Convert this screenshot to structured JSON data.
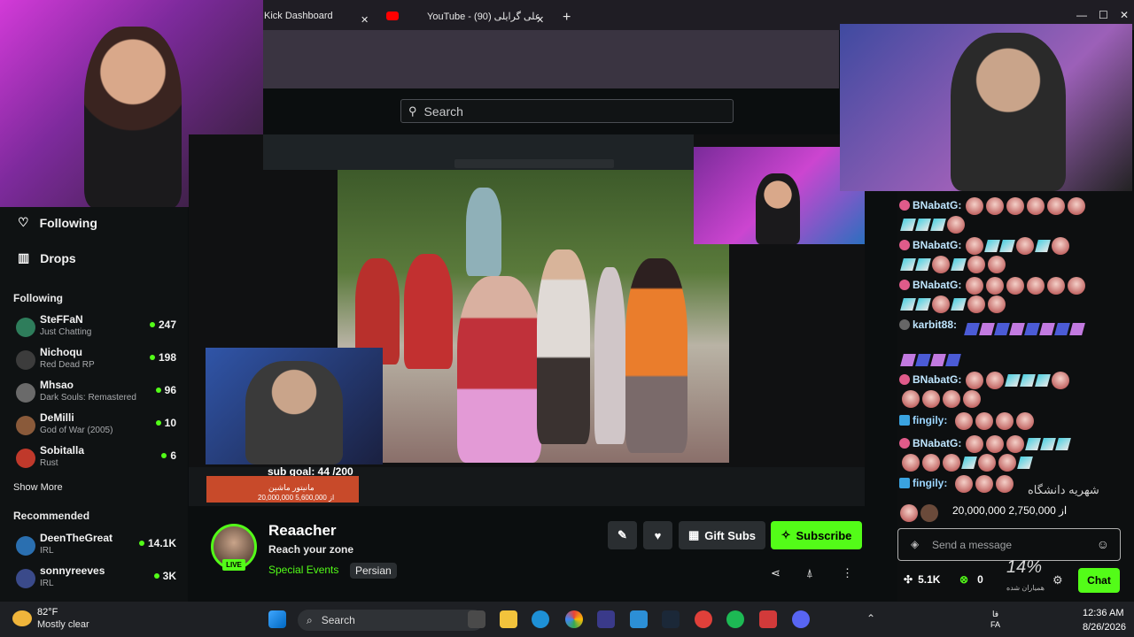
{
  "browser": {
    "tabs": [
      {
        "label": "Kick Dashboard"
      },
      {
        "label": "YouTube - علی گرایلی (90)"
      }
    ]
  },
  "search": {
    "placeholder": "Search"
  },
  "sidebar": {
    "following_label": "Following",
    "drops_label": "Drops",
    "following_title": "Following",
    "following": [
      {
        "name": "SteFFaN",
        "category": "Just Chatting",
        "viewers": "247"
      },
      {
        "name": "Nichoqu",
        "category": "Red Dead RP",
        "viewers": "198"
      },
      {
        "name": "Mhsao",
        "category": "Dark Souls: Remastered",
        "viewers": "96"
      },
      {
        "name": "DeMilli",
        "category": "God of War (2005)",
        "viewers": "10"
      },
      {
        "name": "Sobitalla",
        "category": "Rust",
        "viewers": "6"
      }
    ],
    "show_more": "Show More",
    "recommended_title": "Recommended",
    "recommended": [
      {
        "name": "DeenTheGreat",
        "category": "IRL",
        "viewers": "14.1K"
      },
      {
        "name": "sonnyreeves",
        "category": "IRL",
        "viewers": "3K"
      }
    ]
  },
  "overlay": {
    "sub_goal": "sub goal: 44 /200",
    "donation_title": "مانیتور ماشین",
    "donation_amount": "20,000,000 از 5,600,000"
  },
  "channel": {
    "name": "Reaacher",
    "title": "Reach your zone",
    "category": "Special Events",
    "tag": "Persian",
    "live": "LIVE",
    "gift_label": "Gift Subs",
    "subscribe_label": "Subscribe"
  },
  "chat": {
    "messages": [
      {
        "user": "BNabatG:",
        "color": "#bfe6ff"
      },
      {
        "user": "BNabatG:",
        "color": "#bfe6ff"
      },
      {
        "user": "BNabatG:",
        "color": "#bfe6ff"
      },
      {
        "user": "karbit88:",
        "color": "#bfe6ff"
      },
      {
        "user": "BNabatG:",
        "color": "#bfe6ff"
      },
      {
        "user": "fingily:",
        "color": "#9dd7ff"
      },
      {
        "user": "BNabatG:",
        "color": "#bfe6ff"
      },
      {
        "user": "fingily:",
        "color": "#9dd7ff"
      }
    ],
    "overlay_text": "20,000,000 از 2,750,000",
    "overlay_fa": "شهریه دانشگاه",
    "percent": "14%",
    "percent_sub": "همیاران شده",
    "input_placeholder": "Send a message",
    "kicks": "5.1K",
    "points": "0",
    "chat_button": "Chat"
  },
  "taskbar": {
    "temperature": "82°F",
    "weather": "Mostly clear",
    "search_label": "Search",
    "lang1": "فا",
    "lang2": "FA",
    "time": "12:36 AM",
    "date": "8/26/2026"
  },
  "colors": {
    "accent": "#53fc18",
    "bg": "#0b0e0f"
  }
}
